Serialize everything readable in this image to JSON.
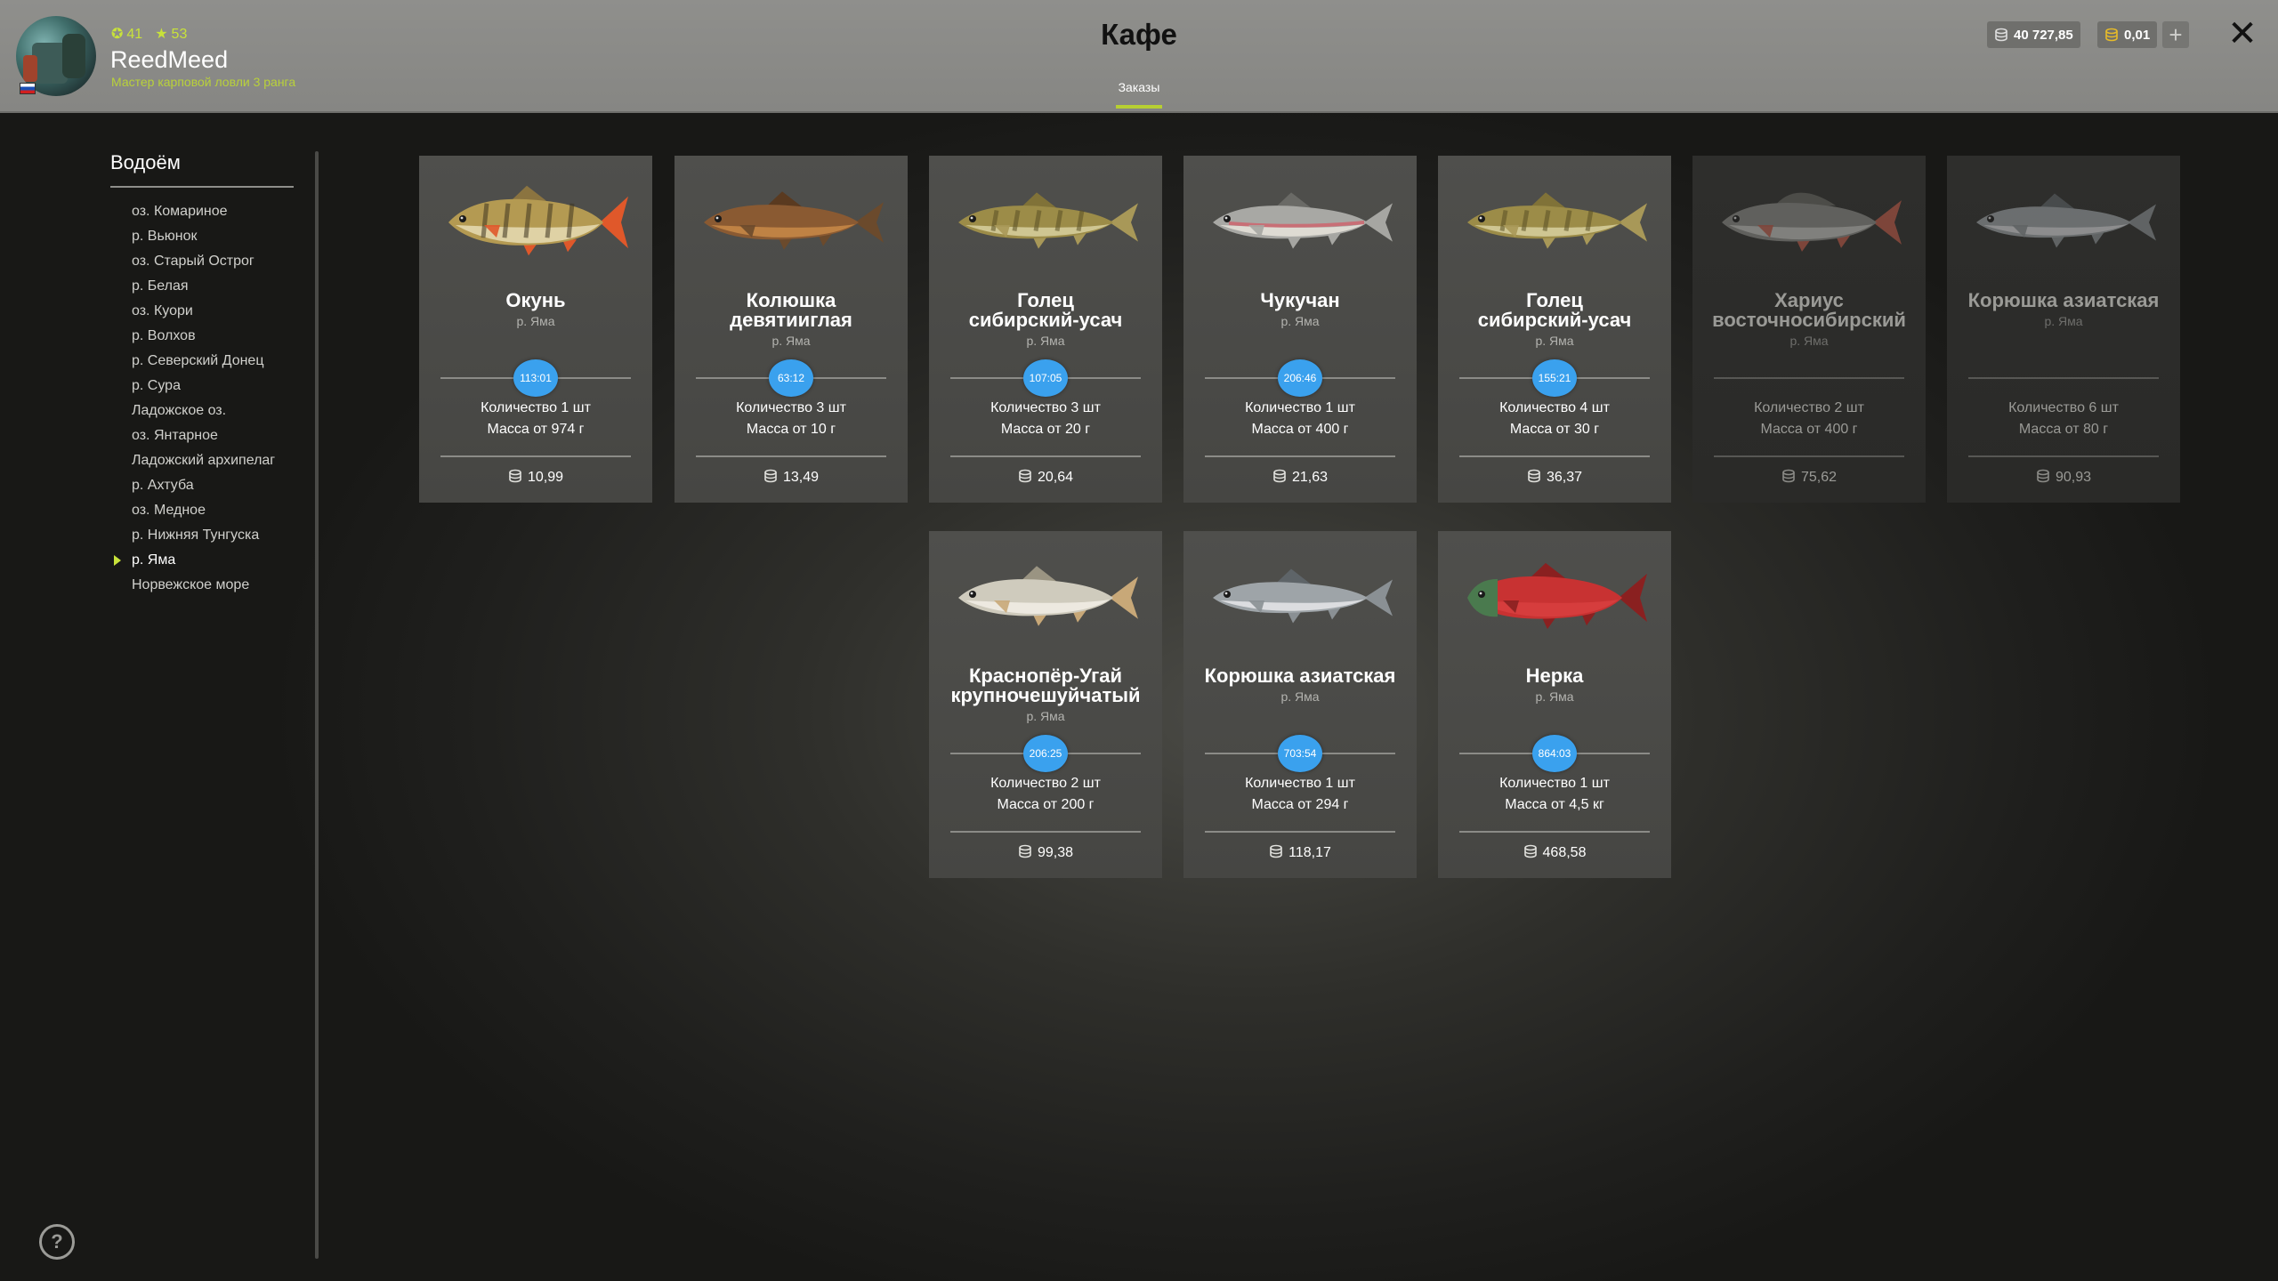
{
  "player": {
    "level": "41",
    "stars": "53",
    "name": "ReedMeed",
    "rank": "Мастер карповой ловли 3 ранга"
  },
  "header": {
    "title": "Кафе",
    "tab": "Заказы",
    "silver": "40 727,85",
    "gold": "0,01",
    "add_label": "+",
    "close_label": "✕"
  },
  "sidebar": {
    "title": "Водоём",
    "items": [
      "оз. Комариное",
      "р. Вьюнок",
      "оз. Старый Острог",
      "р. Белая",
      "оз. Куори",
      "р. Волхов",
      "р. Северский Донец",
      "р. Сура",
      "Ладожское оз.",
      "оз. Янтарное",
      "Ладожский архипелаг",
      "р. Ахтуба",
      "оз. Медное",
      "р. Нижняя Тунгуска",
      "р. Яма",
      "Норвежское море"
    ],
    "active": "р. Яма"
  },
  "orders": [
    {
      "name1": "Окунь",
      "name2": "",
      "loc": "р. Яма",
      "timer": "113:01",
      "qty": "Количество 1 шт",
      "mass": "Масса от 974 г",
      "price": "10,99",
      "available": true,
      "fish": "perch"
    },
    {
      "name1": "Колюшка",
      "name2": "девятииглая",
      "loc": "р. Яма",
      "timer": "63:12",
      "qty": "Количество 3 шт",
      "mass": "Масса от 10 г",
      "price": "13,49",
      "available": true,
      "fish": "stickleback"
    },
    {
      "name1": "Голец",
      "name2": "сибирский-усач",
      "loc": "р. Яма",
      "timer": "107:05",
      "qty": "Количество 3 шт",
      "mass": "Масса от 20 г",
      "price": "20,64",
      "available": true,
      "fish": "loach"
    },
    {
      "name1": "Чукучан",
      "name2": "",
      "loc": "р. Яма",
      "timer": "206:46",
      "qty": "Количество 1 шт",
      "mass": "Масса от 400 г",
      "price": "21,63",
      "available": true,
      "fish": "sucker"
    },
    {
      "name1": "Голец",
      "name2": "сибирский-усач",
      "loc": "р. Яма",
      "timer": "155:21",
      "qty": "Количество 4 шт",
      "mass": "Масса от 30 г",
      "price": "36,37",
      "available": true,
      "fish": "loach"
    },
    {
      "name1": "Хариус",
      "name2": "восточносибирский",
      "loc": "р. Яма",
      "timer": "",
      "qty": "Количество 2 шт",
      "mass": "Масса от 400 г",
      "price": "75,62",
      "available": false,
      "fish": "grayling"
    },
    {
      "name1": "Корюшка азиатская",
      "name2": "",
      "loc": "р. Яма",
      "timer": "",
      "qty": "Количество 6 шт",
      "mass": "Масса от 80 г",
      "price": "90,93",
      "available": false,
      "fish": "smelt"
    },
    {
      "name1": "Краснопёр-Угай",
      "name2": "крупночешуйчатый",
      "loc": "р. Яма",
      "timer": "206:25",
      "qty": "Количество 2 шт",
      "mass": "Масса от 200 г",
      "price": "99,38",
      "available": true,
      "fish": "dace"
    },
    {
      "name1": "Корюшка азиатская",
      "name2": "",
      "loc": "р. Яма",
      "timer": "703:54",
      "qty": "Количество 1 шт",
      "mass": "Масса от 294 г",
      "price": "118,17",
      "available": true,
      "fish": "smelt"
    },
    {
      "name1": "Нерка",
      "name2": "",
      "loc": "р. Яма",
      "timer": "864:03",
      "qty": "Количество 1 шт",
      "mass": "Масса от 4,5 кг",
      "price": "468,58",
      "available": true,
      "fish": "sockeye"
    }
  ],
  "help_label": "?",
  "colors": {
    "accent": "#b7cf32",
    "timer": "#3aa1ee",
    "header": "#8a8a87"
  }
}
